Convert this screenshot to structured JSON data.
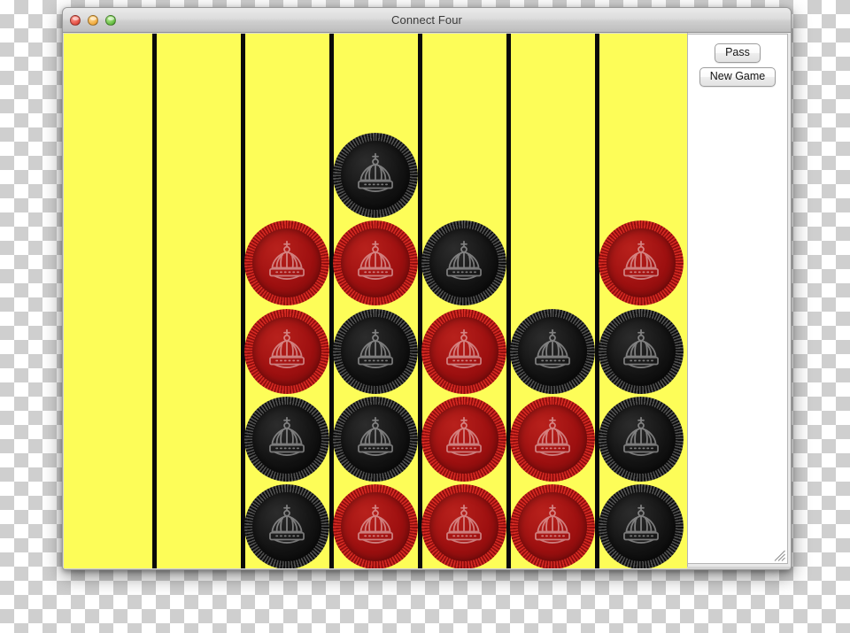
{
  "window": {
    "title": "Connect Four",
    "controls": [
      {
        "name": "close",
        "label": "Close"
      },
      {
        "name": "minimize",
        "label": "Minimize"
      },
      {
        "name": "maximize",
        "label": "Maximize"
      }
    ],
    "resize_grip_icon": "resize-grip-icon"
  },
  "side_panel": {
    "pass_label": "Pass",
    "new_game_label": "New Game"
  },
  "board": {
    "rows": 5,
    "columns": 7,
    "background_color": "#fdfd58",
    "divider_color": "#0a0a0a",
    "red_color": "#9e1010",
    "black_color": "#141414",
    "disc_emblem": "crown-icon",
    "grid": [
      [
        "empty",
        "empty",
        "empty",
        "black",
        "empty",
        "empty",
        "empty"
      ],
      [
        "empty",
        "empty",
        "red",
        "red",
        "black",
        "empty",
        "red"
      ],
      [
        "empty",
        "empty",
        "red",
        "black",
        "red",
        "black",
        "black"
      ],
      [
        "empty",
        "empty",
        "black",
        "black",
        "red",
        "red",
        "black"
      ],
      [
        "empty",
        "empty",
        "black",
        "red",
        "red",
        "red",
        "black"
      ]
    ]
  }
}
